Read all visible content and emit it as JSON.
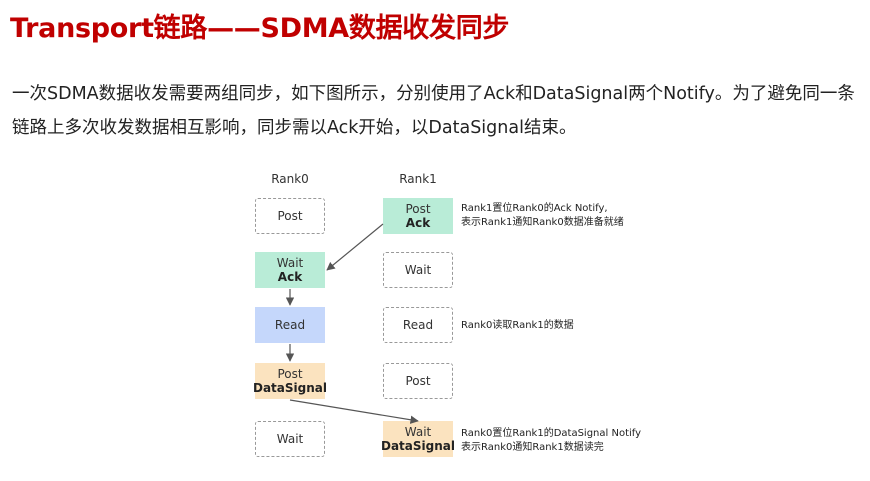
{
  "title": "Transport链路——SDMA数据收发同步",
  "description": "一次SDMA数据收发需要两组同步，如下图所示，分别使用了Ack和DataSignal两个Notify。为了避免同一条链路上多次收发数据相互影响，同步需以Ack开始，以DataSignal结束。",
  "diagram": {
    "rank0": {
      "header": "Rank0",
      "steps": [
        {
          "label": "Post",
          "sub": ""
        },
        {
          "label": "Wait",
          "sub": "Ack"
        },
        {
          "label": "Read",
          "sub": ""
        },
        {
          "label": "Post",
          "sub": "DataSignal"
        },
        {
          "label": "Wait",
          "sub": ""
        }
      ]
    },
    "rank1": {
      "header": "Rank1",
      "steps": [
        {
          "label": "Post",
          "sub": "Ack"
        },
        {
          "label": "Wait",
          "sub": ""
        },
        {
          "label": "Read",
          "sub": ""
        },
        {
          "label": "Post",
          "sub": ""
        },
        {
          "label": "Wait",
          "sub": "DataSignal"
        }
      ]
    },
    "notes": {
      "ack_line1": "Rank1置位Rank0的Ack Notify,",
      "ack_line2": "表示Rank1通知Rank0数据准备就绪",
      "read": "Rank0读取Rank1的数据",
      "signal_line1": "Rank0置位Rank1的DataSignal Notify",
      "signal_line2": "表示Rank0通知Rank1数据读完"
    },
    "colors": {
      "title": "#c00000",
      "active_green": "#b9ecd7",
      "read_blue": "#c5d7fb",
      "signal_orange": "#fbe3bf",
      "inactive_border": "#999999",
      "arrow": "#555555"
    }
  }
}
